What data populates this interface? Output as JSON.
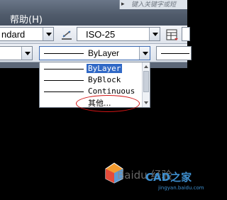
{
  "menubar": {
    "help_menu": "帮助(H)",
    "help_search_placeholder": "键入关键字或短"
  },
  "toolbar1": {
    "text_style_value": "ndard",
    "dim_style_value": "ISO-25"
  },
  "toolbar2": {
    "linetype_value": "ByLayer"
  },
  "linetype_dropdown": {
    "options": [
      {
        "label": "ByLayer",
        "selected": true
      },
      {
        "label": "ByBlock",
        "selected": false
      },
      {
        "label": "Continuous",
        "selected": false
      },
      {
        "label": "其他...",
        "selected": false
      }
    ]
  },
  "watermark": {
    "text": "Baidu 经验",
    "brand": "CAD之家",
    "url": "jingyan.baidu.com"
  },
  "colors": {
    "canvas": "#000000",
    "selection": "#3169c6",
    "annotation": "#d21414"
  }
}
